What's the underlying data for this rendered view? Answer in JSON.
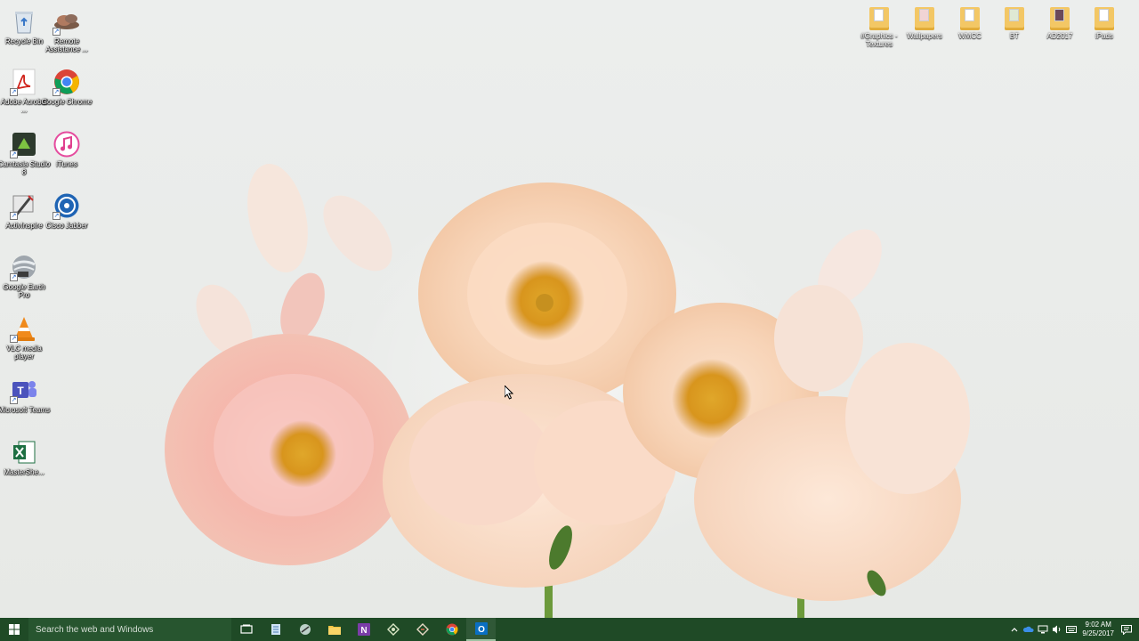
{
  "desktop": {
    "left_icons": [
      {
        "label": "Recycle Bin",
        "icon": "recycle-bin-icon"
      },
      {
        "label": "Remote Assistance ...",
        "icon": "remote-assistance-icon"
      },
      {
        "label": "Adobe Acrobat ...",
        "icon": "acrobat-icon"
      },
      {
        "label": "Google Chrome",
        "icon": "chrome-icon"
      },
      {
        "label": "Camtasia Studio 8",
        "icon": "camtasia-icon"
      },
      {
        "label": "iTunes",
        "icon": "itunes-icon"
      },
      {
        "label": "ActivInspire",
        "icon": "activinspire-icon"
      },
      {
        "label": "Cisco Jabber",
        "icon": "cisco-jabber-icon"
      },
      {
        "label": "Google Earth Pro",
        "icon": "google-earth-icon"
      },
      {
        "label": "VLC media player",
        "icon": "vlc-icon"
      },
      {
        "label": "Microsoft Teams",
        "icon": "teams-icon"
      },
      {
        "label": "MasterShe...",
        "icon": "excel-icon"
      }
    ],
    "right_folders": [
      {
        "label": "#Graphics - Textures"
      },
      {
        "label": "Wallpapers"
      },
      {
        "label": "WMCC"
      },
      {
        "label": "BT"
      },
      {
        "label": "AD2017"
      },
      {
        "label": "iPads"
      }
    ]
  },
  "taskbar": {
    "search_placeholder": "Search the web and Windows",
    "apps": [
      {
        "icon": "task-view-icon"
      },
      {
        "icon": "notepad-icon"
      },
      {
        "icon": "snipping-icon"
      },
      {
        "icon": "file-explorer-icon"
      },
      {
        "icon": "onenote-icon"
      },
      {
        "icon": "app-icon-1"
      },
      {
        "icon": "app-icon-2"
      },
      {
        "icon": "chrome-icon"
      },
      {
        "icon": "outlook-icon"
      }
    ],
    "clock_time": "9:02 AM",
    "clock_date": "9/25/2017"
  },
  "colors": {
    "taskbar": "#1f4a26",
    "search_box": "#27552f",
    "folder": "#f3c765"
  }
}
